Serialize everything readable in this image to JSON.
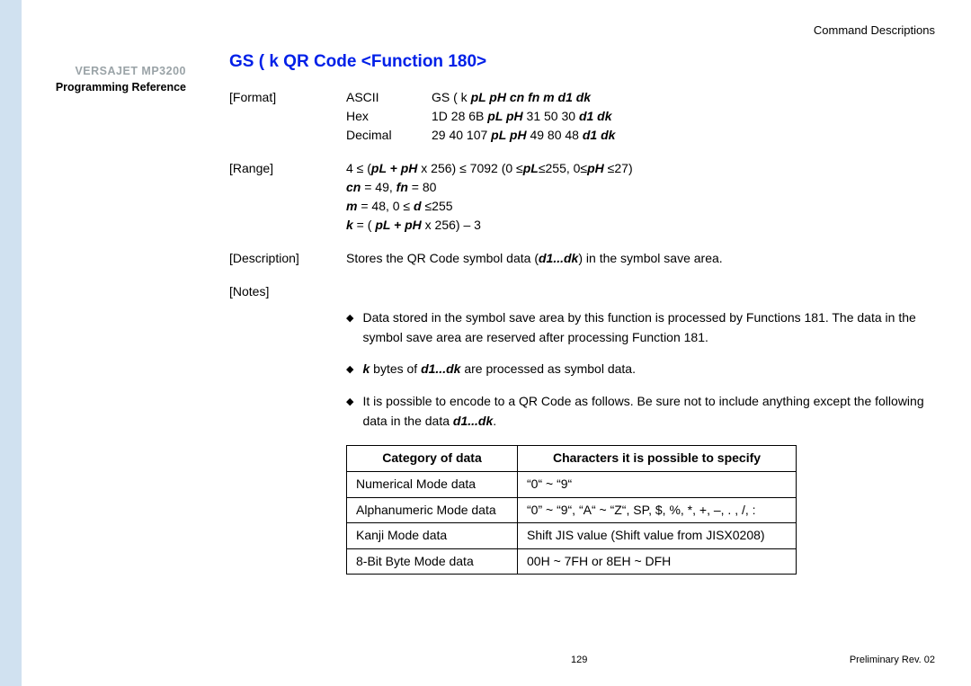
{
  "sidebar": {
    "model": "VERSAJET MP3200",
    "subtitle": "Programming Reference"
  },
  "header": {
    "corner": "Command  Descriptions",
    "title": "GS ( k    QR Code <Function 180>"
  },
  "format": {
    "label": "[Format]",
    "ascii_lbl": "ASCII",
    "hex_lbl": "Hex",
    "dec_lbl": "Decimal",
    "ascii_pre": "GS ( k ",
    "ascii_bi": "pL pH cn fn m d1 dk",
    "hex_pre": "1D 28 6B ",
    "hex_mid_bi": "pL pH",
    "hex_mid_plain": " 31 50 30 ",
    "hex_end_bi": "d1 dk",
    "dec_pre": "29 40 107 ",
    "dec_mid_bi": "pL pH",
    "dec_mid_plain": " 49 80 48 ",
    "dec_end_bi": "d1 dk"
  },
  "range": {
    "label": "[Range]",
    "l1a": "4 ≤ (",
    "l1b": "pL + pH",
    "l1c": " x 256) ≤ 7092 (0 ≤",
    "l1d": "pL",
    "l1e": "≤255, 0≤",
    "l1f": "pH",
    "l1g": " ≤27)",
    "l2a": "cn",
    "l2b": " = 49, ",
    "l2c": "fn",
    "l2d": " = 80",
    "l3a": "m",
    "l3b": " = 48, 0 ≤ ",
    "l3c": "d",
    "l3d": " ≤255",
    "l4a": "k",
    "l4b": " = ( ",
    "l4c": "pL + pH",
    "l4d": " x 256) – 3"
  },
  "description": {
    "label": "[Description]",
    "t1": "Stores the QR Code symbol data (",
    "t2": "d1...dk",
    "t3": ") in the symbol save area."
  },
  "notes": {
    "label": "[Notes]",
    "b1": "Data stored in the symbol save area by this function is processed by Functions 181. The data in the symbol save area are reserved after processing Function 181.",
    "b2a": "k",
    "b2b": " bytes of ",
    "b2c": "d1...dk",
    "b2d": " are processed as symbol data.",
    "b3a": "It is possible to encode to a QR Code as follows. Be sure not to include anything except the following data in the data ",
    "b3b": "d1...dk",
    "b3c": "."
  },
  "table": {
    "h1": "Category of data",
    "h2": "Characters it is possible to specify",
    "r1c1": "Numerical Mode data",
    "r1c2": "“0“ ~ “9“",
    "r2c1": "Alphanumeric Mode data",
    "r2c2": "“0” ~ “9“, “A“ ~ “Z“, SP, $, %, *, +, –, . , /, :",
    "r3c1": "Kanji Mode data",
    "r3c2": "Shift JIS value (Shift value from JISX0208)",
    "r4c1": "8-Bit Byte Mode data",
    "r4c2": "00H ~ 7FH or 8EH ~ DFH"
  },
  "footer": {
    "page": "129",
    "rev": "Preliminary Rev. 02"
  }
}
